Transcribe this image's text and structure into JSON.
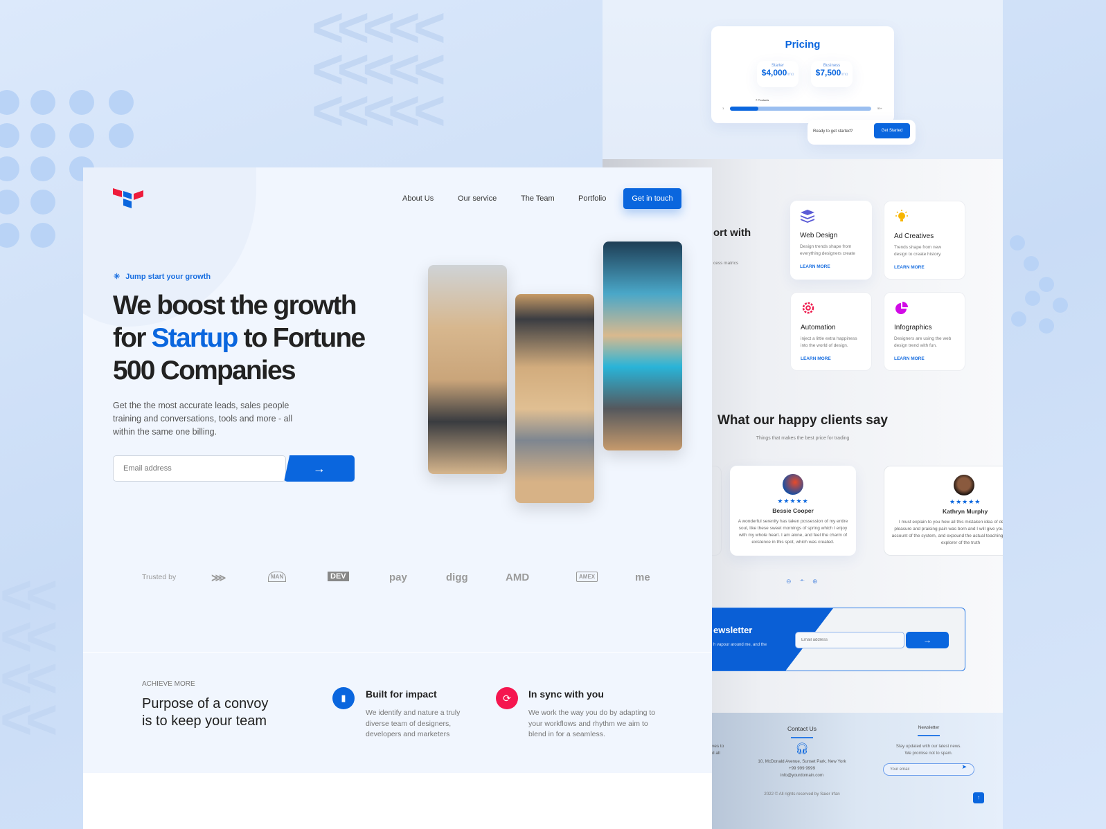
{
  "colors": {
    "accent": "#0a66de",
    "red": "#ee1c3b",
    "dark": "#222222"
  },
  "pricing": {
    "title": "Pricing",
    "plans": [
      {
        "name": "Starter",
        "price": "$4,000",
        "unit": "/mo"
      },
      {
        "name": "Business",
        "price": "$7,500",
        "unit": "/mo"
      }
    ],
    "slider": {
      "min": "1",
      "max": "50+",
      "label": "7 Products",
      "value_fraction": 0.2
    },
    "cta_text": "Ready to get started?",
    "cta_button": "Get Started"
  },
  "services": {
    "heading_partial": "ort with",
    "sub_partial": "cess matrics",
    "items": [
      {
        "title": "Web Design",
        "desc": "Design trends shape from everything designers create",
        "link": "LEARN MORE",
        "icon": "layers-icon"
      },
      {
        "title": "Ad Creatives",
        "desc": "Trends shape from new design to create history.",
        "link": "LEARN MORE",
        "icon": "lightbulb-icon"
      },
      {
        "title": "Automation",
        "desc": "inject a little extra happiness into the world of design.",
        "link": "LEARN MORE",
        "icon": "gear-icon"
      },
      {
        "title": "Infographics",
        "desc": "Designers are using the web design trend with fun.",
        "link": "LEARN MORE",
        "icon": "pie-chart-icon"
      }
    ]
  },
  "testimonials": {
    "title": "What our happy clients say",
    "subtitle": "Things that makes the best price for trading",
    "items": [
      {
        "name": "Bessie Cooper",
        "rating": 5,
        "text": "A wonderful serenity has taken possession of my entire soul, like these sweet mornings of spring which I enjoy with my whole heart. I am alone, and feel the charm of existence in this spot, which was created."
      },
      {
        "name": "Kathryn Murphy",
        "rating": 5,
        "text": "I must explain to you how all this mistaken idea of denouncing pleasure and praising pain was born and I will give you a complete account of the system, and expound the actual teachings of the great explorer of the truth"
      }
    ]
  },
  "newsletter_band": {
    "title_partial": "ewsletter",
    "sub_partial": "h vapour around me, and the",
    "placeholder": "Email address"
  },
  "footer": {
    "partial_lines": [
      "ves to",
      "d all"
    ],
    "contact_title": "Contact Us",
    "address": "10, McDonald Avenue, Sunset Park, New York",
    "phone": "+99 999 9999",
    "email": "info@yourdomain.com",
    "newsletter_title": "Newsletter",
    "newsletter_text_1": "Stay updated with our latest news.",
    "newsletter_text_2": "We promise not to spam.",
    "email_placeholder": "Your email",
    "copyright": "2022 © All rights reserved by Saier Irfan"
  },
  "nav": {
    "items": [
      "About Us",
      "Our service",
      "The Team",
      "Portfolio"
    ],
    "cta": "Get in touch"
  },
  "hero": {
    "eyebrow": "Jump start your growth",
    "title_1": "We boost the growth",
    "title_2a": "for ",
    "title_2b": "Startup",
    "title_2c": " to Fortune",
    "title_3": "500 Companies",
    "desc": "Get the the most accurate leads, sales people training and conversations, tools and more - all within the same one billing.",
    "email_placeholder": "Email address"
  },
  "trusted": {
    "label": "Trusted by",
    "logos": [
      "Haskell",
      "MAN",
      "DEV",
      "pay",
      "digg",
      "AMD",
      "AMEX",
      "me"
    ]
  },
  "achieve": {
    "eyebrow": "ACHIEVE MORE",
    "title": "Purpose of a convoy is to keep your team",
    "features": [
      {
        "title": "Built for impact",
        "desc": "We identify and nature a truly diverse team of designers, developers and marketers",
        "icon": "bar-chart-icon"
      },
      {
        "title": "In sync with you",
        "desc": "We work the way you do by adapting to your workflows and rhythm we aim to blend in for a seamless.",
        "icon": "sync-icon"
      }
    ]
  }
}
